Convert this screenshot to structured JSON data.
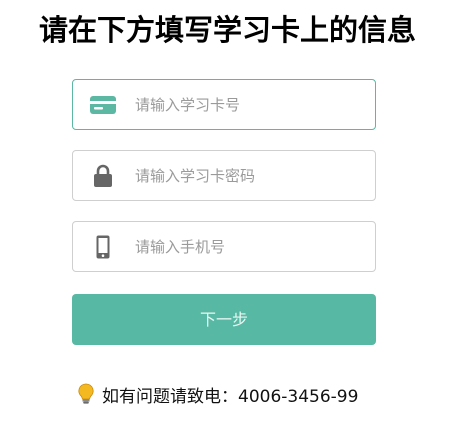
{
  "page": {
    "title": "请在下方填写学习卡上的信息"
  },
  "form": {
    "card_number": {
      "placeholder": "请输入学习卡号",
      "value": "",
      "icon": "credit-card-icon",
      "icon_color": "#5cb8a3"
    },
    "card_password": {
      "placeholder": "请输入学习卡密码",
      "value": "",
      "icon": "lock-icon",
      "icon_color": "#666666"
    },
    "phone": {
      "placeholder": "请输入手机号",
      "value": "",
      "icon": "mobile-phone-icon",
      "icon_color": "#666666"
    },
    "next_button": {
      "label": "下一步",
      "color": "#57b8a4"
    }
  },
  "help": {
    "text": "如有问题请致电：4006-3456-99",
    "icon": "lightbulb-icon"
  }
}
